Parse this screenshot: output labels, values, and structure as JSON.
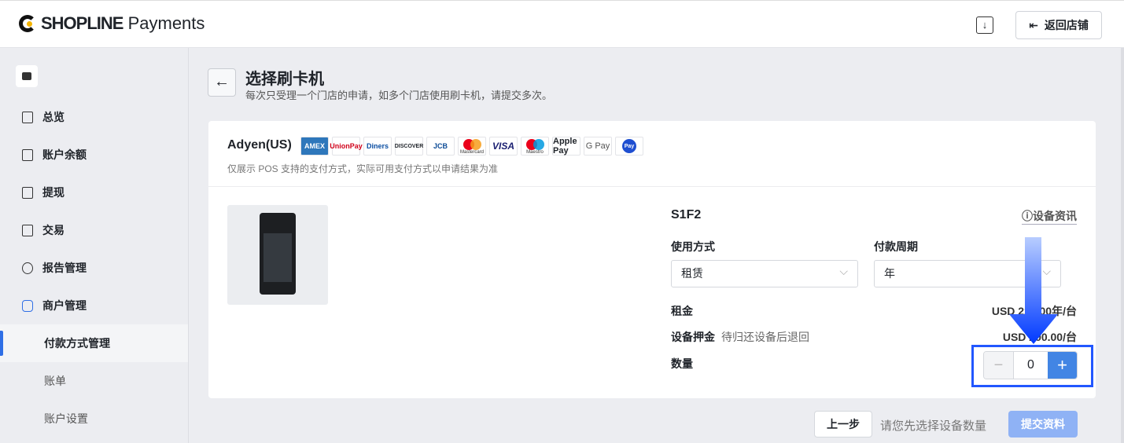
{
  "header": {
    "brand_bold": "SHOPLINE",
    "brand_rest": " Payments",
    "back_to_store": "返回店铺"
  },
  "sidebar": {
    "items": [
      {
        "label": "总览",
        "top": "138"
      },
      {
        "label": "账户余额"
      },
      {
        "label": "提现"
      },
      {
        "label": "交易"
      },
      {
        "label": "报告管理"
      },
      {
        "label": "商户管理"
      }
    ],
    "subitems": [
      {
        "label": "付款方式管理"
      },
      {
        "label": "账单"
      },
      {
        "label": "账户设置"
      }
    ]
  },
  "page": {
    "title": "选择刷卡机",
    "subtitle": "每次只受理一个门店的申请，如多个门店使用刷卡机，请提交多次。"
  },
  "provider": {
    "name": "Adyen(US)",
    "payment_methods": [
      "AMEX",
      "UnionPay",
      "Diners",
      "DISCOVER",
      "JCB",
      "Mastercard",
      "VISA",
      "Maestro",
      "Apple Pay",
      "G Pay",
      "Pay"
    ],
    "note": "仅展示 POS 支持的支付方式，实际可用支付方式以申请结果为准"
  },
  "device": {
    "model": "S1F2",
    "info_link": "设备资讯",
    "usage_label": "使用方式",
    "usage_value": "租赁",
    "period_label": "付款周期",
    "period_value": "年",
    "rent_label": "租金",
    "rent_value": "USD 220.00年/台",
    "deposit_label": "设备押金",
    "deposit_desc": "待归还设备后退回",
    "deposit_value": "USD 200.00/台",
    "qty_label": "数量",
    "qty_value": "0"
  },
  "footer": {
    "prev": "上一步",
    "hint": "请您先选择设备数量",
    "submit": "提交资料"
  },
  "colors": {
    "accent": "#4285e4",
    "highlight": "#2257ff"
  }
}
